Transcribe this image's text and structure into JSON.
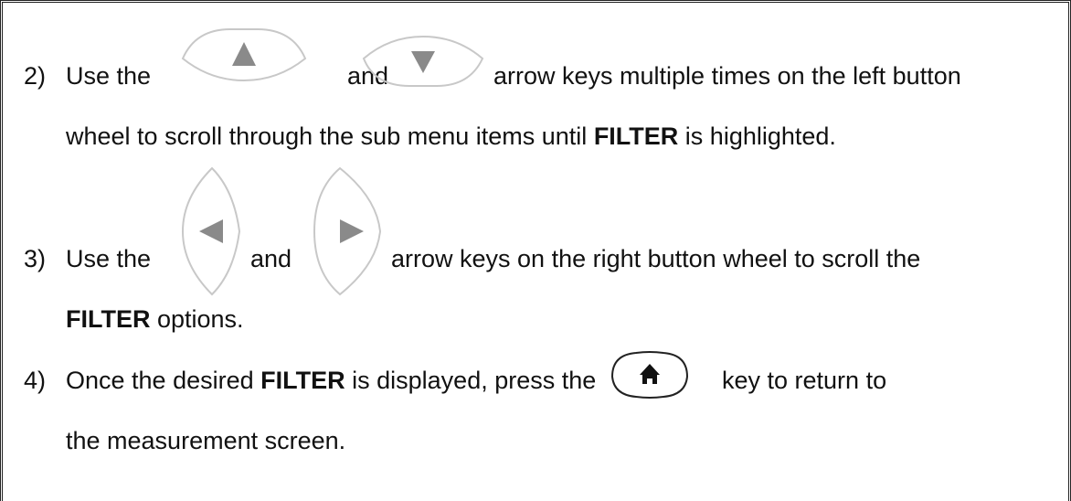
{
  "steps": [
    {
      "number": "2)",
      "use_the": "Use the",
      "and": "and",
      "after_keys": "arrow keys multiple times on the left button",
      "line2_pre": "wheel to scroll through the sub menu items until ",
      "line2_bold": "FILTER",
      "line2_post": " is highlighted.",
      "keys": [
        "up-arrow-key",
        "down-arrow-key"
      ]
    },
    {
      "number": "3)",
      "use_the": "Use the",
      "and": "and",
      "after_keys": "arrow keys on the right button wheel to scroll the",
      "line2_bold": "FILTER",
      "line2_post": " options.",
      "keys": [
        "left-arrow-key",
        "right-arrow-key"
      ]
    },
    {
      "number": "4)",
      "pre": "Once the desired ",
      "bold": "FILTER",
      "mid": " is displayed, press the",
      "after_key": "key to return to",
      "line2": "the measurement screen.",
      "keys": [
        "home-key"
      ]
    }
  ],
  "colors": {
    "key_outline": "#c8c8c8",
    "key_arrow": "#8a8a8a",
    "home_icon": "#111111",
    "frame": "#222222"
  }
}
